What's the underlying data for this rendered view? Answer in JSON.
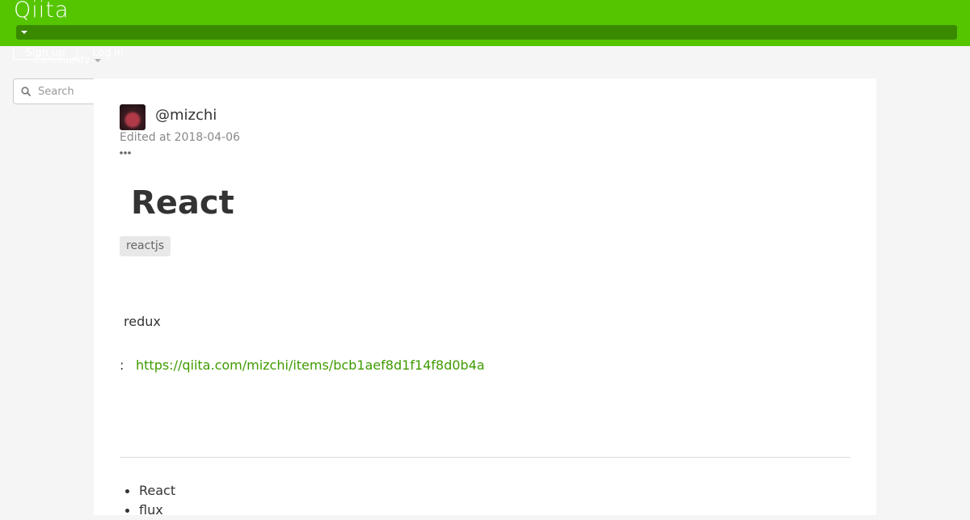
{
  "header": {
    "logo_text": "Qiita",
    "signup_label": "Sign up",
    "login_label": "Log in",
    "community_label": "Community",
    "accent_color": "#55c500"
  },
  "search": {
    "placeholder": "Search"
  },
  "article": {
    "author": "@mizchi",
    "edited": "Edited at 2018-04-06",
    "title": "React",
    "tags": [
      "reactjs"
    ],
    "body_text": "redux",
    "link_prefix": ":",
    "link_url": "https://qiita.com/mizchi/items/bcb1aef8d1f14f8d0b4a",
    "list_items": [
      "React",
      "flux"
    ]
  },
  "icons": {
    "search": "search-icon",
    "more": "more-icon",
    "caret": "chevron-down-icon"
  }
}
